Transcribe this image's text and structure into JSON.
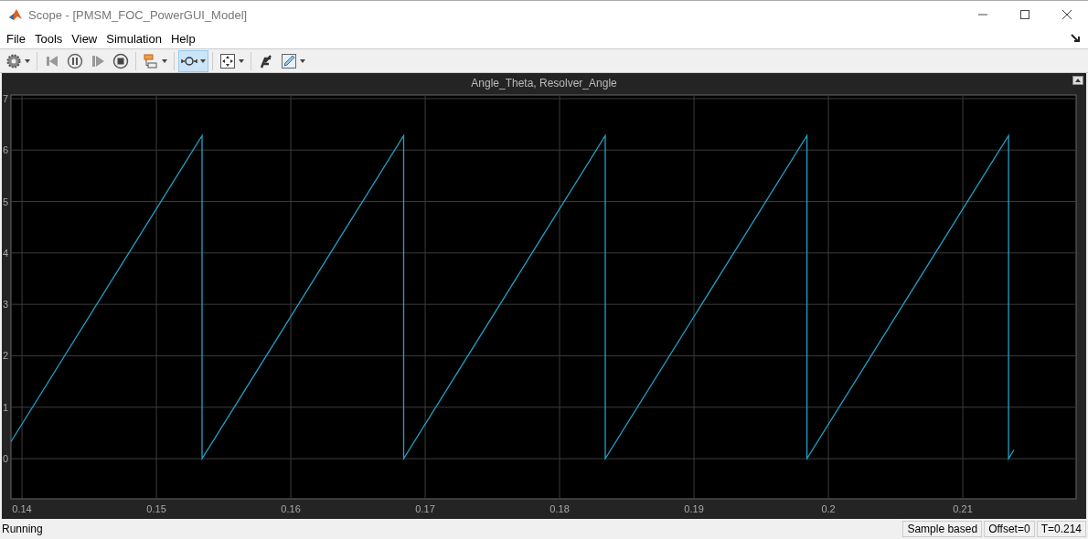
{
  "window": {
    "title": "Scope - [PMSM_FOC_PowerGUI_Model]"
  },
  "menu": [
    "File",
    "Tools",
    "View",
    "Simulation",
    "Help"
  ],
  "toolbar": [
    {
      "kind": "gear",
      "caret": true,
      "selected": false
    },
    {
      "kind": "sep"
    },
    {
      "kind": "stepback",
      "caret": false,
      "selected": false
    },
    {
      "kind": "pause",
      "caret": false,
      "selected": false
    },
    {
      "kind": "stepforward",
      "caret": false,
      "selected": false
    },
    {
      "kind": "stop",
      "caret": false,
      "selected": false
    },
    {
      "kind": "sep"
    },
    {
      "kind": "highlight",
      "caret": true,
      "selected": false
    },
    {
      "kind": "sep"
    },
    {
      "kind": "zoom",
      "caret": true,
      "selected": true
    },
    {
      "kind": "sep"
    },
    {
      "kind": "fit",
      "caret": true,
      "selected": false
    },
    {
      "kind": "sep"
    },
    {
      "kind": "cursor",
      "caret": false,
      "selected": false
    },
    {
      "kind": "style",
      "caret": true,
      "selected": false
    }
  ],
  "plot": {
    "chart_data": {
      "type": "line",
      "title": "Angle_Theta, Resolver_Angle",
      "grid": true,
      "xlim": [
        0.13918,
        0.21843
      ],
      "ylim": [
        -0.78,
        7.07
      ],
      "xticks": [
        {
          "value": 0.14,
          "label": "0.14"
        },
        {
          "value": 0.15,
          "label": "0.15"
        },
        {
          "value": 0.16,
          "label": "0.16"
        },
        {
          "value": 0.17,
          "label": "0.17"
        },
        {
          "value": 0.18,
          "label": "0.18"
        },
        {
          "value": 0.19,
          "label": "0.19"
        },
        {
          "value": 0.2,
          "label": "0.2"
        },
        {
          "value": 0.21,
          "label": "0.21"
        }
      ],
      "yticks": [
        0,
        1,
        2,
        3,
        4,
        5,
        6,
        7
      ],
      "x": [
        0.13918,
        0.1534,
        0.1534,
        0.1684,
        0.1684,
        0.1834,
        0.1834,
        0.1984,
        0.1984,
        0.2134,
        0.2134,
        0.2138
      ],
      "series": [
        {
          "color": "#1fa3c8",
          "values": [
            0.33,
            6.28,
            0,
            6.28,
            0,
            6.28,
            0,
            6.28,
            0,
            6.28,
            0,
            0.17
          ]
        }
      ]
    }
  },
  "status": {
    "text": "Running",
    "cells": [
      "Sample based",
      "Offset=0",
      "T=0.214"
    ]
  }
}
